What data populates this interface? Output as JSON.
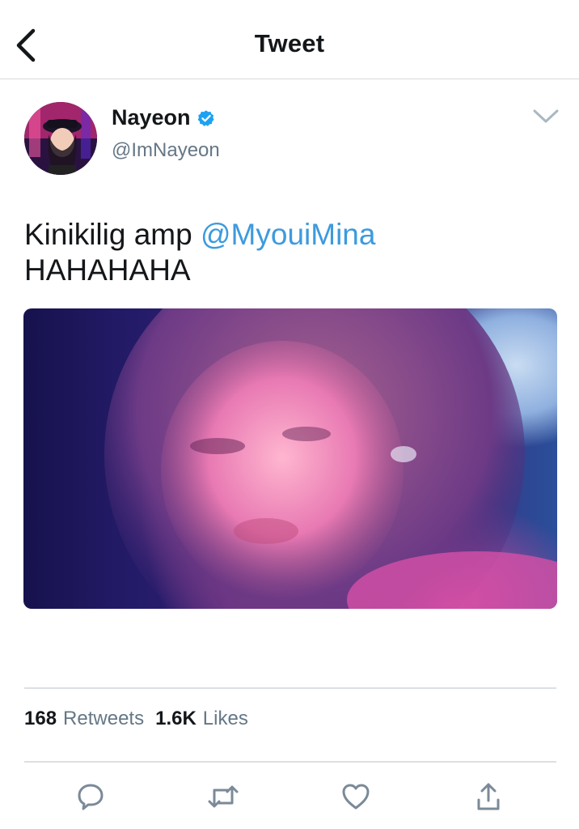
{
  "nav": {
    "title": "Tweet"
  },
  "tweet": {
    "author_name": "Nayeon",
    "author_handle": "@ImNayeon",
    "text_prefix": "Kinikilig amp ",
    "mention": "@MyouiMina",
    "text_line2": "HAHAHAHA",
    "retweet_count": "168",
    "retweet_label": "Retweets",
    "like_count": "1.6K",
    "like_label": "Likes"
  },
  "colors": {
    "link": "#3d9ade",
    "secondary_text": "#657786",
    "verified_badge": "#1da1f2",
    "icon_gray": "#7b8a98"
  },
  "icons": {
    "back": "chevron-left-icon",
    "verified": "verified-badge-icon",
    "menu": "chevron-down-icon",
    "reply": "reply-icon",
    "retweet": "retweet-icon",
    "like": "heart-icon",
    "share": "share-icon"
  }
}
